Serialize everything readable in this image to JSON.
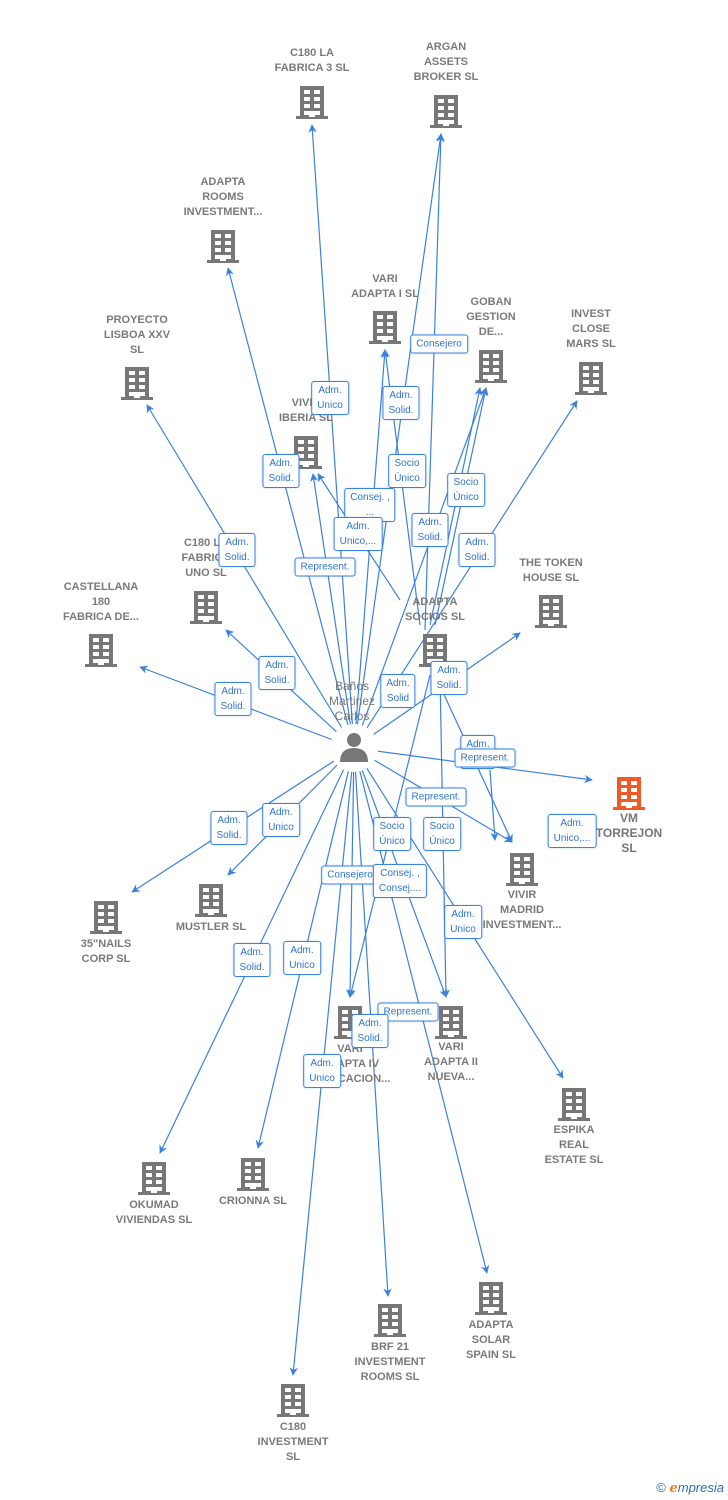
{
  "colors": {
    "edge": "#3b82dd",
    "node": "#777777",
    "highlight": "#f05a28",
    "role_text": "#2f74cf"
  },
  "person": {
    "name_lines": [
      "Baños",
      "Martinez",
      "Carlos"
    ],
    "icon": "person-icon"
  },
  "nodes": [
    {
      "id": "c180-la-fabrica-3",
      "lines": [
        "C180 LA",
        "FABRICA 3  SL"
      ],
      "icon": "building-icon"
    },
    {
      "id": "argan-assets-broker",
      "lines": [
        "ARGAN",
        "ASSETS",
        "BROKER  SL"
      ],
      "icon": "building-icon"
    },
    {
      "id": "adapta-rooms-investment",
      "lines": [
        "ADAPTA",
        "ROOMS",
        "INVESTMENT..."
      ],
      "icon": "building-icon"
    },
    {
      "id": "vari-adapta-i",
      "lines": [
        "VARI",
        "ADAPTA I  SL"
      ],
      "icon": "building-icon"
    },
    {
      "id": "goban-gestion",
      "lines": [
        "GOBAN",
        "GESTION",
        "DE..."
      ],
      "icon": "building-icon"
    },
    {
      "id": "invest-close-mars",
      "lines": [
        "INVEST",
        "CLOSE",
        "MARS  SL"
      ],
      "icon": "building-icon"
    },
    {
      "id": "proyecto-lisboa-xxv",
      "lines": [
        "PROYECTO",
        "LISBOA XXV",
        "SL"
      ],
      "icon": "building-icon"
    },
    {
      "id": "vivir-iberia",
      "lines": [
        "VIVIR",
        "IBERIA  SL"
      ],
      "icon": "building-icon"
    },
    {
      "id": "c180-la-fabrica-uno",
      "lines": [
        "C180 LA",
        "FABRICA",
        "UNO  SL"
      ],
      "icon": "building-icon"
    },
    {
      "id": "castellana-180",
      "lines": [
        "CASTELLANA",
        "180",
        "FABRICA DE..."
      ],
      "icon": "building-icon"
    },
    {
      "id": "the-token-house",
      "lines": [
        "THE TOKEN",
        "HOUSE  SL"
      ],
      "icon": "building-icon"
    },
    {
      "id": "adapta-socios",
      "lines": [
        "ADAPTA",
        "SOCIOS  SL"
      ],
      "icon": "building-icon"
    },
    {
      "id": "vm-torrejon",
      "lines": [
        "VM",
        "TORREJON",
        "SL"
      ],
      "icon": "building-icon",
      "highlighted": true
    },
    {
      "id": "vivir-madrid-investment",
      "lines": [
        "VIVIR",
        "MADRID",
        "INVESTMENT..."
      ],
      "icon": "building-icon"
    },
    {
      "id": "35nails-corp",
      "lines": [
        "35\"NAILS",
        "CORP  SL"
      ],
      "icon": "building-icon"
    },
    {
      "id": "mustler",
      "lines": [
        "MUSTLER SL"
      ],
      "icon": "building-icon"
    },
    {
      "id": "vari-adapta-iv",
      "lines": [
        "VARI",
        "ADAPTA IV",
        "EDIFICACION..."
      ],
      "icon": "building-icon"
    },
    {
      "id": "vari-adapta-ii",
      "lines": [
        "VARI",
        "ADAPTA II",
        "NUEVA..."
      ],
      "icon": "building-icon"
    },
    {
      "id": "espika-real-estate",
      "lines": [
        "ESPIKA",
        "REAL",
        "ESTATE  SL"
      ],
      "icon": "building-icon"
    },
    {
      "id": "okumad-viviendas",
      "lines": [
        "OKUMAD",
        "VIVIENDAS  SL"
      ],
      "icon": "building-icon"
    },
    {
      "id": "crionna",
      "lines": [
        "CRIONNA  SL"
      ],
      "icon": "building-icon"
    },
    {
      "id": "brf-21-investment-rooms",
      "lines": [
        "BRF 21",
        "INVESTMENT",
        "ROOMS  SL"
      ],
      "icon": "building-icon"
    },
    {
      "id": "adapta-solar-spain",
      "lines": [
        "ADAPTA",
        "SOLAR",
        "SPAIN  SL"
      ],
      "icon": "building-icon"
    },
    {
      "id": "c180-investment",
      "lines": [
        "C180",
        "INVESTMENT",
        "SL"
      ],
      "icon": "building-icon"
    }
  ],
  "roles": [
    [
      "Consejero"
    ],
    [
      "Adm.",
      "Unico"
    ],
    [
      "Adm.",
      "Solid."
    ],
    [
      "Adm.",
      "Solid."
    ],
    [
      "Socio",
      "Único"
    ],
    [
      "Socio",
      "Único"
    ],
    [
      "Consej. ,",
      "..."
    ],
    [
      "Adm.",
      "Unico,..."
    ],
    [
      "Adm.",
      "Solid."
    ],
    [
      "Adm.",
      "Solid."
    ],
    [
      "Adm.",
      "Solid."
    ],
    [
      "Represent."
    ],
    [
      "Adm.",
      "Solid."
    ],
    [
      "Adm.",
      "Solid."
    ],
    [
      "Adm.",
      "Solid"
    ],
    [
      "Adm.",
      "Solid."
    ],
    [
      "Adm.",
      "..."
    ],
    [
      "Represent."
    ],
    [
      "Represent."
    ],
    [
      "Adm.",
      "Unico,..."
    ],
    [
      "Adm.",
      "Solid."
    ],
    [
      "Adm.",
      "Unico"
    ],
    [
      "Socio",
      "Único"
    ],
    [
      "Socio",
      "Único"
    ],
    [
      "Consejero"
    ],
    [
      "Consej. ,",
      "Consej...."
    ],
    [
      "Adm.",
      "Unico"
    ],
    [
      "Adm.",
      "Solid."
    ],
    [
      "Adm.",
      "Unico"
    ],
    [
      "Represent."
    ],
    [
      "Adm.",
      "Solid."
    ],
    [
      "Adm.",
      "Unico"
    ]
  ],
  "footer": {
    "copyright": "©",
    "brand_initial": "e",
    "brand_rest": "mpresia"
  }
}
